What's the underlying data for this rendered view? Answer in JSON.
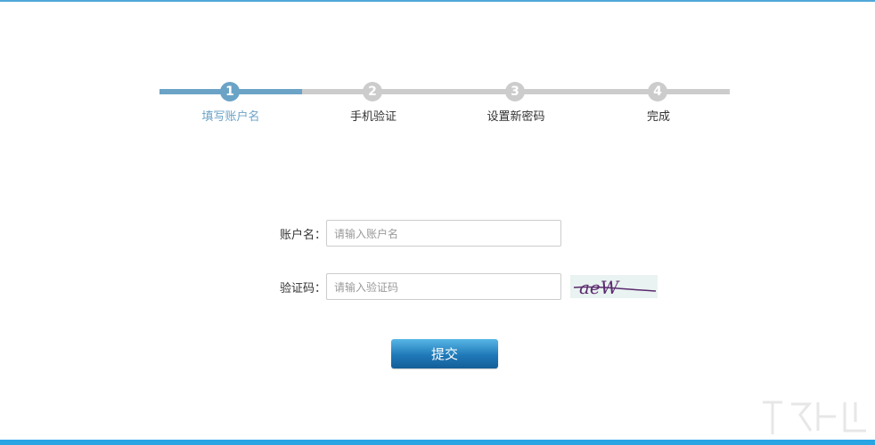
{
  "stepper": {
    "steps": [
      {
        "number": "1",
        "label": "填写账户名",
        "state": "active"
      },
      {
        "number": "2",
        "label": "手机验证",
        "state": "pending"
      },
      {
        "number": "3",
        "label": "设置新密码",
        "state": "pending"
      },
      {
        "number": "4",
        "label": "完成",
        "state": "pending"
      }
    ],
    "active_color": "#6ba3c7",
    "inactive_color": "#cccccc"
  },
  "form": {
    "account_label": "账户名：",
    "account_placeholder": "请输入账户名",
    "captcha_label": "验证码：",
    "captcha_placeholder": "请输入验证码",
    "captcha_text": "aeW"
  },
  "submit_label": "提交",
  "colors": {
    "accent": "#2aa5e4",
    "button_dark": "#145e98"
  }
}
